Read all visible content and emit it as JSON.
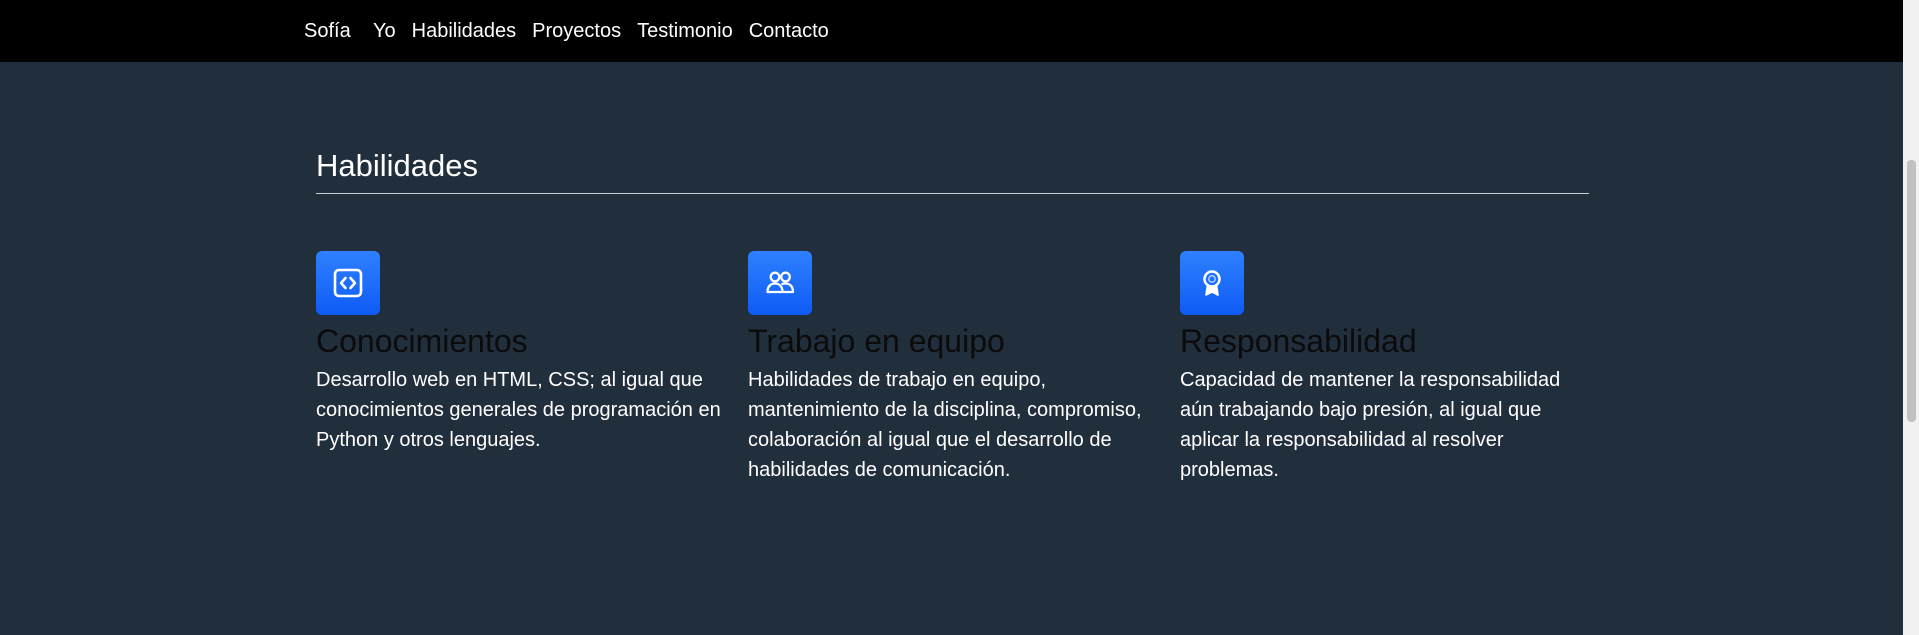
{
  "nav": {
    "brand": "Sofía",
    "links": [
      {
        "label": "Yo"
      },
      {
        "label": "Habilidades"
      },
      {
        "label": "Proyectos"
      },
      {
        "label": "Testimonio"
      },
      {
        "label": "Contacto"
      }
    ]
  },
  "section": {
    "title": "Habilidades"
  },
  "skills": [
    {
      "icon": "code-icon",
      "title": "Conocimientos",
      "description": "Desarrollo web en HTML, CSS; al igual que conocimientos generales de programación en Python y otros lenguajes."
    },
    {
      "icon": "people-icon",
      "title": "Trabajo en equipo",
      "description": "Habilidades de trabajo en equipo, mantenimiento de la disciplina, compromiso, colaboración al igual que el desarrollo de habilidades de comunicación."
    },
    {
      "icon": "award-icon",
      "title": "Responsabilidad",
      "description": "Capacidad de mantener la responsabilidad aún trabajando bajo presión, al igual que aplicar la responsabilidad al resolver problemas."
    }
  ],
  "colors": {
    "page_background": "#212f3d",
    "navbar_background": "#000000",
    "icon_background": "#1769ff",
    "text": "#ffffff",
    "skill_title": "#0b0b0b"
  }
}
